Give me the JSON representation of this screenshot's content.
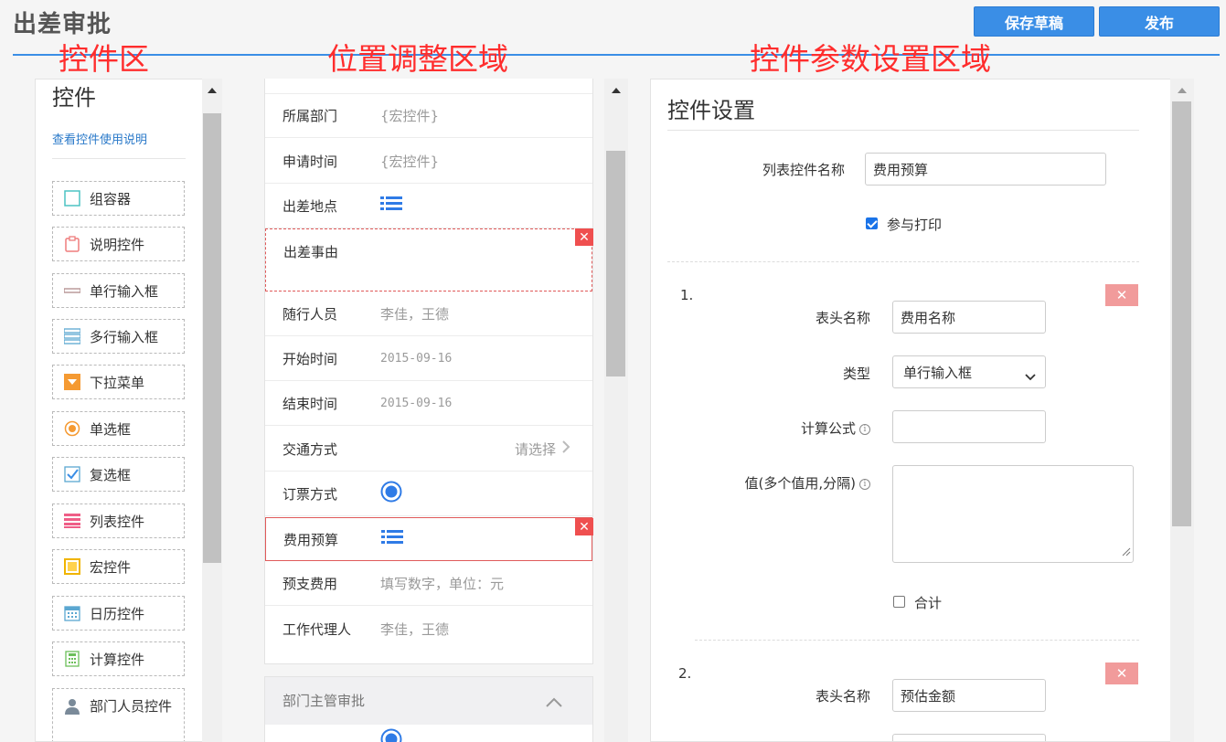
{
  "header": {
    "title": "出差审批",
    "save_label": "保存草稿",
    "publish_label": "发布"
  },
  "region_labels": {
    "controls": "控件区",
    "position": "位置调整区域",
    "settings": "控件参数设置区域"
  },
  "left": {
    "title": "控件",
    "help_link": "查看控件使用说明",
    "items": [
      {
        "label": "组容器",
        "icon": "container-icon"
      },
      {
        "label": "说明控件",
        "icon": "clipboard-icon"
      },
      {
        "label": "单行输入框",
        "icon": "single-line-input-icon"
      },
      {
        "label": "多行输入框",
        "icon": "multi-line-input-icon"
      },
      {
        "label": "下拉菜单",
        "icon": "dropdown-icon"
      },
      {
        "label": "单选框",
        "icon": "radio-icon"
      },
      {
        "label": "复选框",
        "icon": "checkbox-icon"
      },
      {
        "label": "列表控件",
        "icon": "list-icon"
      },
      {
        "label": "宏控件",
        "icon": "macro-icon"
      },
      {
        "label": "日历控件",
        "icon": "calendar-icon"
      },
      {
        "label": "计算控件",
        "icon": "calculator-icon"
      },
      {
        "label": "部门人员控件",
        "icon": "person-icon"
      }
    ]
  },
  "middle": {
    "rows": [
      {
        "label": "所属部门",
        "value": "{宏控件}"
      },
      {
        "label": "申请时间",
        "value": "{宏控件}"
      },
      {
        "label": "出差地点",
        "value": ""
      },
      {
        "label": "出差事由",
        "value": ""
      },
      {
        "label": "随行人员",
        "value": "李佳，王德"
      },
      {
        "label": "开始时间",
        "value": "2015-09-16"
      },
      {
        "label": "结束时间",
        "value": "2015-09-16"
      },
      {
        "label": "交通方式",
        "value": "请选择"
      },
      {
        "label": "订票方式",
        "value": ""
      },
      {
        "label": "费用预算",
        "value": ""
      },
      {
        "label": "预支费用",
        "value": "填写数字，单位：元"
      },
      {
        "label": "工作代理人",
        "value": "李佳，王德"
      }
    ],
    "section_title": "部门主管审批"
  },
  "right": {
    "title": "控件设置",
    "list_name_label": "列表控件名称",
    "list_name_value": "费用预算",
    "print_label": "参与打印",
    "print_checked": true,
    "column1": {
      "index": "1.",
      "header_label": "表头名称",
      "header_value": "费用名称",
      "type_label": "类型",
      "type_value": "单行输入框",
      "formula_label": "计算公式",
      "formula_value": "",
      "values_label": "值(多个值用,分隔)",
      "sum_label": "合计",
      "sum_checked": false
    },
    "column2": {
      "index": "2.",
      "header_label": "表头名称",
      "header_value": "预估金额"
    }
  },
  "colors": {
    "accent": "#3a8ee6",
    "danger": "#ef4f4f",
    "region_label": "#ff2d2d"
  }
}
